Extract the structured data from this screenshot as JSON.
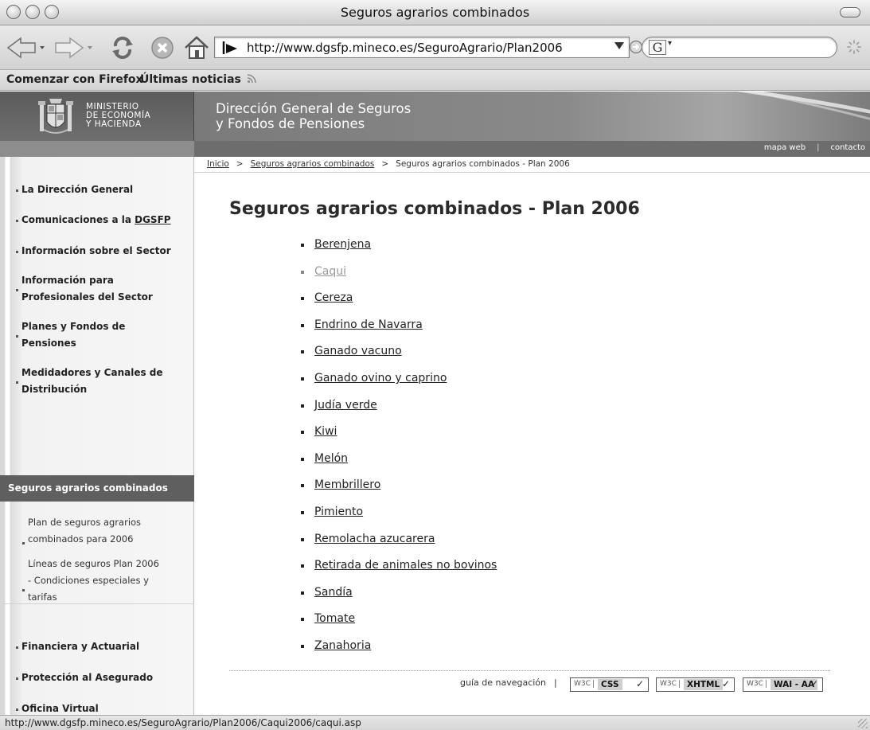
{
  "window": {
    "title": "Seguros agrarios combinados"
  },
  "toolbar": {
    "url": "http://www.dgsfp.mineco.es/SeguroAgrario/Plan2006",
    "search_engine_label": "G"
  },
  "bookmarks": [
    {
      "label": "Comenzar con Firefox"
    },
    {
      "label": "Últimas noticias"
    }
  ],
  "header": {
    "ministry_lines": [
      "MINISTERIO",
      "DE ECONOMÍA",
      "Y HACIENDA"
    ],
    "site_title_lines": [
      "Dirección General de Seguros",
      "y Fondos de Pensiones"
    ],
    "util_links": [
      "mapa web",
      "contacto"
    ]
  },
  "breadcrumb": [
    "Inicio",
    "Seguros agrarios combinados",
    "Seguros agrarios combinados - Plan 2006"
  ],
  "sidebar": {
    "items_top": [
      {
        "lines": [
          "La Dirección General"
        ]
      },
      {
        "lines": [
          "Comunicaciones a la ",
          "DGSFP"
        ]
      },
      {
        "lines": [
          "Información sobre el Sector"
        ]
      },
      {
        "lines": [
          "Información para",
          "Profesionales del Sector"
        ]
      },
      {
        "lines": [
          "Planes y Fondos de",
          "Pensiones"
        ]
      },
      {
        "lines": [
          "Medidadores y Canales de",
          "Distribución"
        ]
      }
    ],
    "section_title": "Seguros agrarios combinados",
    "sub_items": [
      {
        "lines": [
          "Plan de seguros agrarios",
          "combinados para 2006"
        ]
      },
      {
        "lines": [
          "Líneas de seguros Plan 2006",
          "- Condiciones especiales y",
          "tarifas"
        ]
      }
    ],
    "items_bottom": [
      {
        "lines": [
          "Financiera y Actuarial"
        ]
      },
      {
        "lines": [
          "Protección al Asegurado"
        ]
      },
      {
        "lines": [
          "Oficina Virtual"
        ]
      }
    ]
  },
  "main": {
    "heading": "Seguros agrarios combinados - Plan 2006",
    "crops": [
      {
        "label": "Berenjena",
        "visited": false
      },
      {
        "label": "Caqui",
        "visited": true
      },
      {
        "label": "Cereza",
        "visited": false
      },
      {
        "label": "Endrino de Navarra",
        "visited": false
      },
      {
        "label": "Ganado vacuno",
        "visited": false
      },
      {
        "label": "Ganado ovino y caprino",
        "visited": false
      },
      {
        "label": "Judía verde",
        "visited": false
      },
      {
        "label": "Kiwi",
        "visited": false
      },
      {
        "label": "Melón",
        "visited": false
      },
      {
        "label": "Membrillero",
        "visited": false
      },
      {
        "label": "Pimiento",
        "visited": false
      },
      {
        "label": "Remolacha azucarera",
        "visited": false
      },
      {
        "label": "Retirada de animales no bovinos",
        "visited": false
      },
      {
        "label": "Sandía",
        "visited": false
      },
      {
        "label": "Tomate",
        "visited": false
      },
      {
        "label": "Zanahoria",
        "visited": false
      }
    ]
  },
  "footer": {
    "nav_guide": "guía de navegación",
    "separator": "|",
    "badge_prefix": "W3C",
    "badges": [
      "CSS",
      "XHTML",
      "WAI - AA"
    ],
    "badge_check": "✓"
  },
  "statusbar": {
    "text": "http://www.dgsfp.mineco.es/SeguroAgrario/Plan2006/Caqui2006/caqui.asp"
  }
}
